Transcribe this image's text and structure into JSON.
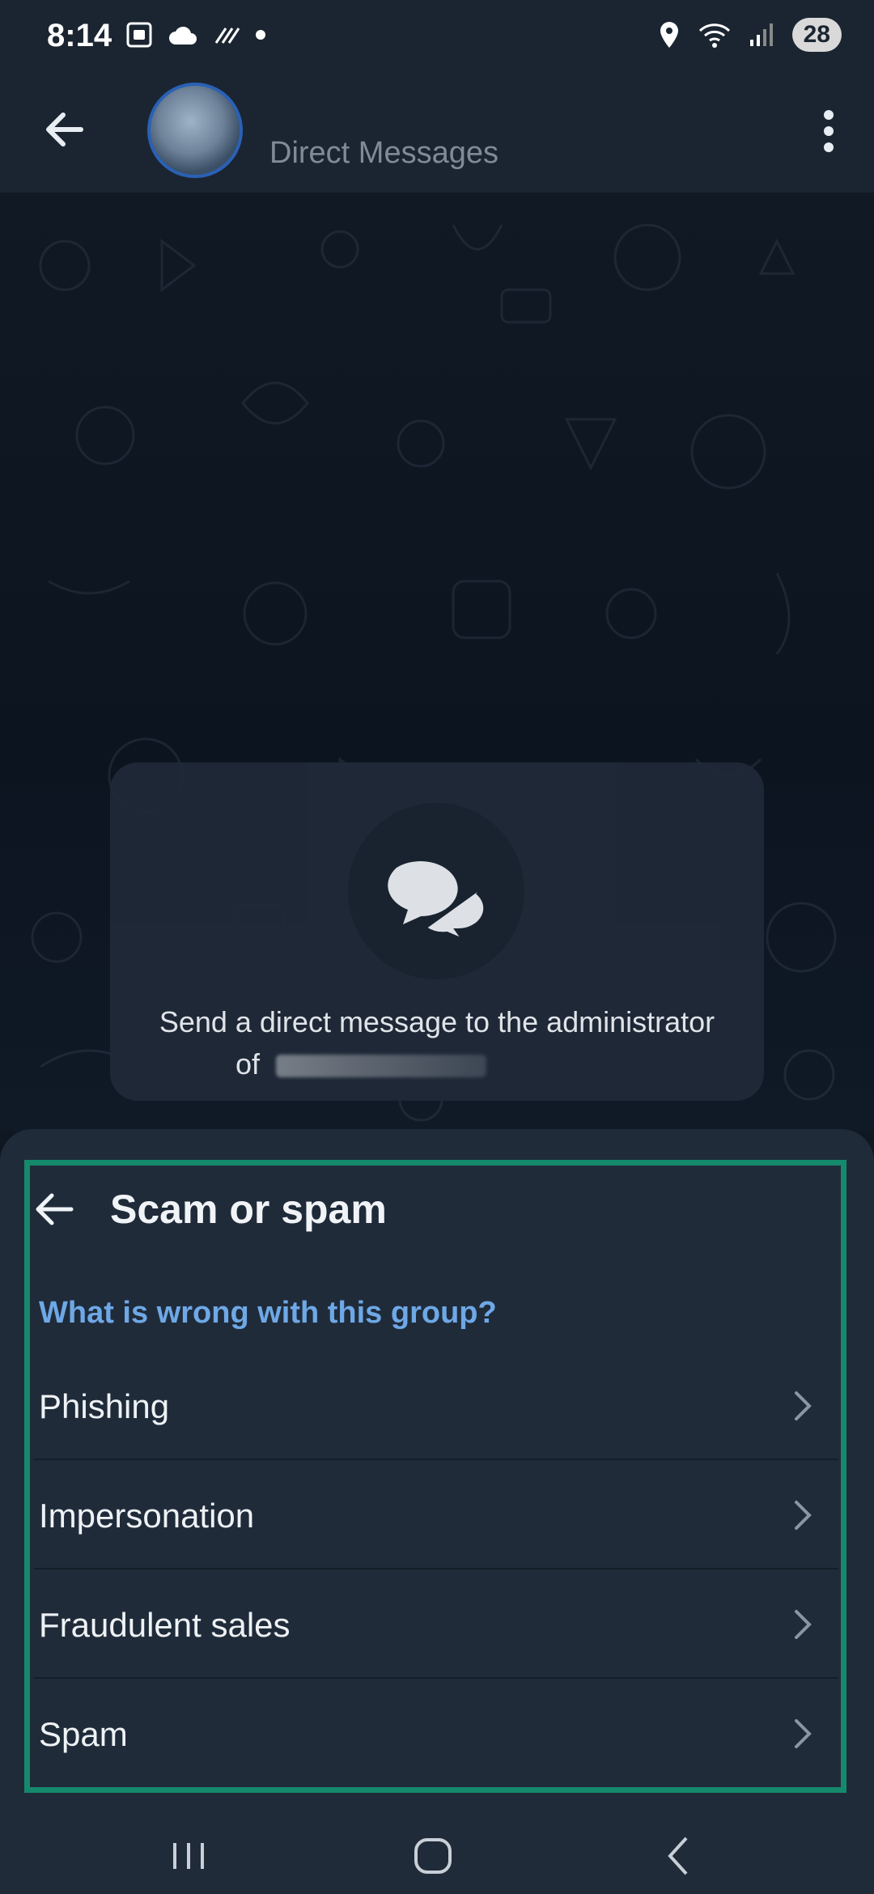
{
  "status_bar": {
    "time": "8:14",
    "battery": "28"
  },
  "chat_header": {
    "title": "Direct Messages"
  },
  "dm_card": {
    "line1": "Send a direct message to the administrator",
    "line2": "of"
  },
  "sheet": {
    "title": "Scam or spam",
    "subtitle": "What is wrong with this group?",
    "options": [
      {
        "label": "Phishing"
      },
      {
        "label": "Impersonation"
      },
      {
        "label": "Fraudulent sales"
      },
      {
        "label": "Spam"
      }
    ]
  },
  "colors": {
    "accent_blue": "#6ea8e6",
    "highlight_green": "#15896c",
    "sheet_bg": "#202b3a"
  }
}
